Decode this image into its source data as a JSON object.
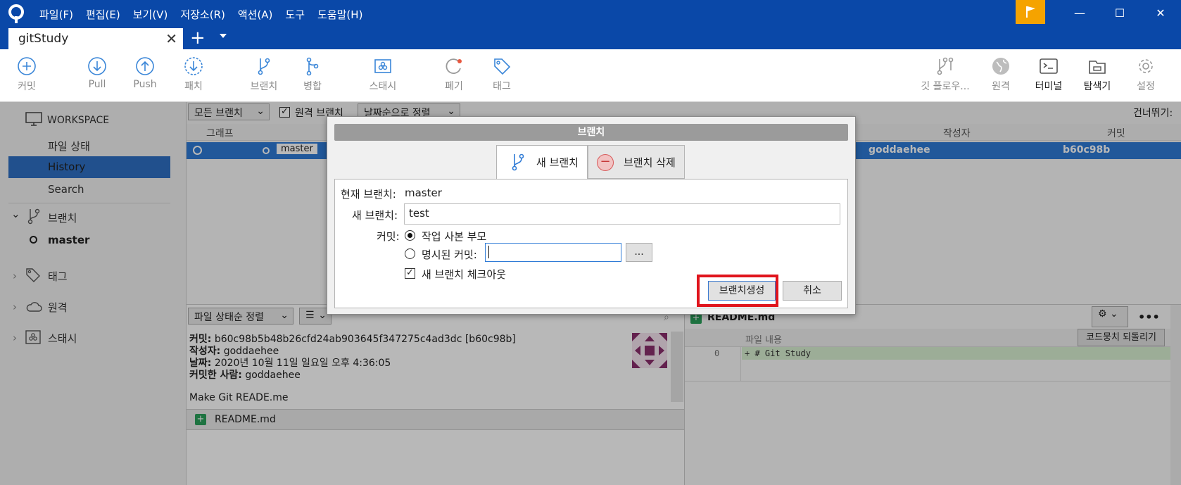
{
  "app": {
    "menu": [
      "파일(F)",
      "편집(E)",
      "보기(V)",
      "저장소(R)",
      "액션(A)",
      "도구",
      "도움말(H)"
    ],
    "tab_title": "gitStudy",
    "window_controls": {
      "minimize": "—",
      "maximize": "☐",
      "close": "✕"
    }
  },
  "toolbar": {
    "commit": "커밋",
    "pull": "Pull",
    "push": "Push",
    "patch": "패치",
    "branch": "브랜치",
    "merge": "병합",
    "stash": "스태시",
    "discard": "폐기",
    "tag": "태그",
    "gitflow": "깃 플로우...",
    "remote": "원격",
    "terminal": "터미널",
    "explorer": "탐색기",
    "settings": "설정"
  },
  "sidebar": {
    "workspace": "WORKSPACE",
    "file_status": "파일 상태",
    "history": "History",
    "search": "Search",
    "branches": "브랜치",
    "branch_master": "master",
    "tags": "태그",
    "remotes": "원격",
    "stashes": "스태시"
  },
  "history": {
    "filter_branches": "모든 브랜치",
    "remote_branches": "원격 브랜치",
    "sort": "날짜순으로 정렬",
    "jump": "건너뛰기:",
    "col_graph": "그래프",
    "col_author": "작성자",
    "col_commit": "커밋",
    "row": {
      "branch": "master",
      "author": "goddaehee",
      "commit": "b60c98b"
    }
  },
  "details": {
    "sort": "파일 상태순 정렬",
    "list_icon": "☰",
    "commit_label": "커밋:",
    "commit_value": "b60c98b5b48b26cfd24ab903645f347275c4ad3dc [b60c98b]",
    "author_label": "작성자:",
    "author_value": "goddaehee",
    "date_label": "날짜:",
    "date_value": "2020년 10월 11일 일요일 오후 4:36:05",
    "committer_label": "커밋한 사람:",
    "committer_value": "goddaehee",
    "message": "Make Git READE.me",
    "file": "README.md"
  },
  "diff": {
    "file": "README.md",
    "content_label": "파일 내용",
    "revert_button": "코드뭉치 되돌리기",
    "line_no": "0",
    "line_text": "+ # Git Study",
    "more": "•••"
  },
  "dialog": {
    "title": "브랜치",
    "tab_new": "새 브랜치",
    "tab_delete": "브랜치 삭제",
    "current_branch_label": "현재 브랜치:",
    "current_branch_value": "master",
    "new_branch_label": "새 브랜치:",
    "new_branch_value": "test",
    "commit_label": "커밋:",
    "option_working_copy": "작업 사본 부모",
    "option_specified": "명시된 커밋:",
    "specified_value": "",
    "browse_button": "...",
    "checkout_label": "새 브랜치 체크아웃",
    "create_button": "브랜치생성",
    "cancel_button": "취소"
  },
  "colors": {
    "titlebar": "#0a48a8",
    "accent": "#2f7bd6",
    "flag": "#f5a300",
    "highlight": "#e0141c",
    "added": "#2aa05a"
  }
}
